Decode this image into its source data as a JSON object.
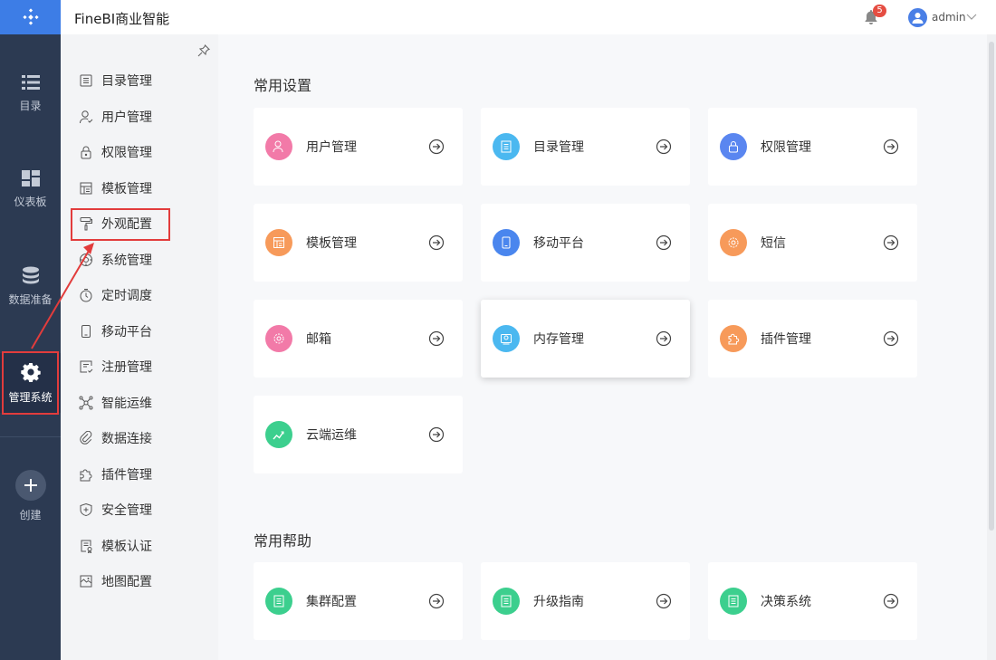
{
  "app": {
    "title": "FineBI商业智能"
  },
  "header": {
    "notification_count": "5",
    "username": "admin"
  },
  "rail": {
    "items": [
      {
        "label": "目录",
        "icon": "list-icon"
      },
      {
        "label": "仪表板",
        "icon": "dashboard-icon"
      },
      {
        "label": "数据准备",
        "icon": "database-icon"
      },
      {
        "label": "管理系统",
        "icon": "gear-icon",
        "active": true
      },
      {
        "label": "创建",
        "icon": "plus-icon"
      }
    ]
  },
  "submenu": {
    "items": [
      {
        "label": "目录管理",
        "icon": "catalog-icon"
      },
      {
        "label": "用户管理",
        "icon": "user-icon"
      },
      {
        "label": "权限管理",
        "icon": "lock-icon"
      },
      {
        "label": "模板管理",
        "icon": "template-icon"
      },
      {
        "label": "外观配置",
        "icon": "paint-roller-icon",
        "highlighted": true
      },
      {
        "label": "系统管理",
        "icon": "system-icon"
      },
      {
        "label": "定时调度",
        "icon": "timer-icon"
      },
      {
        "label": "移动平台",
        "icon": "mobile-icon"
      },
      {
        "label": "注册管理",
        "icon": "register-icon"
      },
      {
        "label": "智能运维",
        "icon": "network-icon"
      },
      {
        "label": "数据连接",
        "icon": "link-icon"
      },
      {
        "label": "插件管理",
        "icon": "puzzle-icon"
      },
      {
        "label": "安全管理",
        "icon": "shield-icon"
      },
      {
        "label": "模板认证",
        "icon": "certify-icon"
      },
      {
        "label": "地图配置",
        "icon": "map-icon"
      }
    ]
  },
  "main": {
    "common_settings_title": "常用设置",
    "common_help_title": "常用帮助",
    "settings_cards": [
      {
        "label": "用户管理",
        "icon": "user-icon",
        "color": "#f27aa8"
      },
      {
        "label": "目录管理",
        "icon": "catalog-icon",
        "color": "#4bb8f0"
      },
      {
        "label": "权限管理",
        "icon": "lock-icon",
        "color": "#5a86f0"
      },
      {
        "label": "模板管理",
        "icon": "template-icon",
        "color": "#f79a5a"
      },
      {
        "label": "移动平台",
        "icon": "mobile-icon",
        "color": "#4a86ee"
      },
      {
        "label": "短信",
        "icon": "gear-icon",
        "color": "#f79a5a"
      },
      {
        "label": "邮箱",
        "icon": "gear-icon",
        "color": "#f27aa8"
      },
      {
        "label": "内存管理",
        "icon": "memory-icon",
        "color": "#4bb8f0"
      },
      {
        "label": "插件管理",
        "icon": "puzzle-icon",
        "color": "#f79a5a"
      },
      {
        "label": "云端运维",
        "icon": "cloud-chart-icon",
        "color": "#3ccf8e"
      }
    ],
    "help_cards": [
      {
        "label": "集群配置",
        "icon": "doc-icon",
        "color": "#3ccf8e"
      },
      {
        "label": "升级指南",
        "icon": "doc-icon",
        "color": "#3ccf8e"
      },
      {
        "label": "决策系统",
        "icon": "doc-icon",
        "color": "#3ccf8e"
      }
    ]
  }
}
